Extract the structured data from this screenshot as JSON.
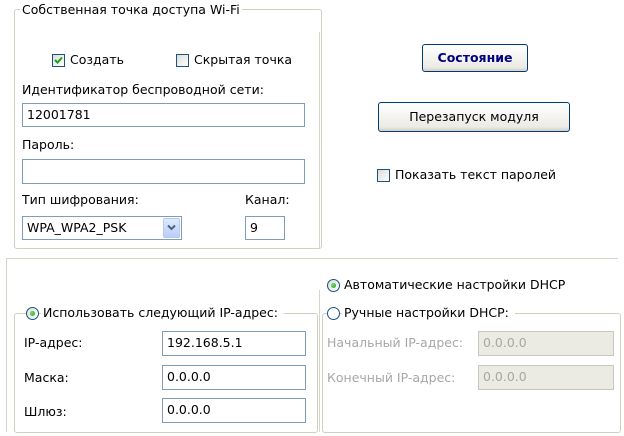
{
  "hotspot": {
    "group_title": "Собственная точка доступа Wi-Fi",
    "create_label": "Создать",
    "create_checked": true,
    "hidden_label": "Скрытая точка",
    "hidden_checked": false,
    "ssid_label": "Идентификатор беспроводной сети:",
    "ssid_value": "12001781",
    "password_label": "Пароль:",
    "password_value": "",
    "encryption_label": "Тип шифрования:",
    "encryption_value": "WPA_WPA2_PSK",
    "channel_label": "Канал:",
    "channel_value": "9"
  },
  "right": {
    "status_button": "Состояние",
    "restart_button": "Перезапуск модуля",
    "show_passwords_label": "Показать текст паролей",
    "show_passwords_checked": false
  },
  "ip": {
    "group_title": "Использовать следующий IP-адрес:",
    "ip_label": "IP-адрес:",
    "ip_value": "192.168.5.1",
    "mask_label": "Маска:",
    "mask_value": "0.0.0.0",
    "gateway_label": "Шлюз:",
    "gateway_value": "0.0.0.0"
  },
  "dhcp": {
    "auto_label": "Автоматические настройки DHCP",
    "manual_label": "Ручные настройки DHCP:",
    "start_label": "Начальный IP-адрес:",
    "start_value": "0.0.0.0",
    "end_label": "Конечный IP-адрес:",
    "end_value": "0.0.0.0"
  },
  "colors": {
    "status_button_text": "#000080",
    "radio_dot": "#21a121",
    "disabled_text": "#a7a7a7"
  }
}
